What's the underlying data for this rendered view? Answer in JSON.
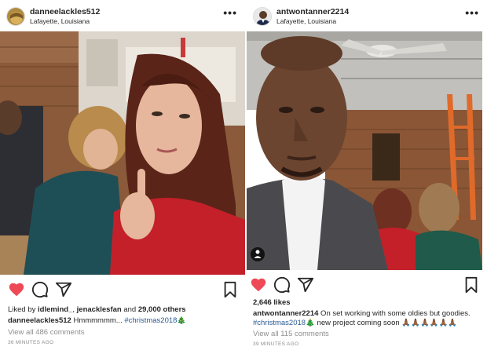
{
  "left_post": {
    "username": "danneelackles512",
    "location": "Lafayette, Louisiana",
    "more_label": "•••",
    "photo_icon": "group-selfie-photo",
    "liked_by_prefix": "Liked by ",
    "liked_by_user1": "idlemind_",
    "liked_by_sep": ", ",
    "liked_by_user2": "jenacklesfan",
    "liked_by_and": " and ",
    "liked_by_others": "29,000 others",
    "caption_user": "danneelackles512",
    "caption_text": " Hmmmmmm... ",
    "caption_tag": "#christmas2018",
    "caption_emoji": "🎄",
    "comments": "View all 486 comments",
    "time": "36 MINUTES AGO"
  },
  "right_post": {
    "username": "antwontanner2214",
    "location": "Lafayette, Louisiana",
    "more_label": "•••",
    "photo_icon": "selfie-photo",
    "likes": "2,646 likes",
    "caption_user": "antwontanner2214",
    "caption_text": " On set working with some oldies but goodies.",
    "caption_tag": "#christmas2018",
    "caption_emoji": "🎄",
    "caption_text2": " new project coming soon ",
    "caption_emoji2": "🙏🏾🙏🏾🙏🏾🙏🏾🙏🏾🙏🏾",
    "comments": "View all 115 comments",
    "time": "39 MINUTES AGO"
  },
  "colors": {
    "heart": "#ed4956",
    "link_blue": "#2a5a94",
    "muted": "#8e8e8e"
  }
}
